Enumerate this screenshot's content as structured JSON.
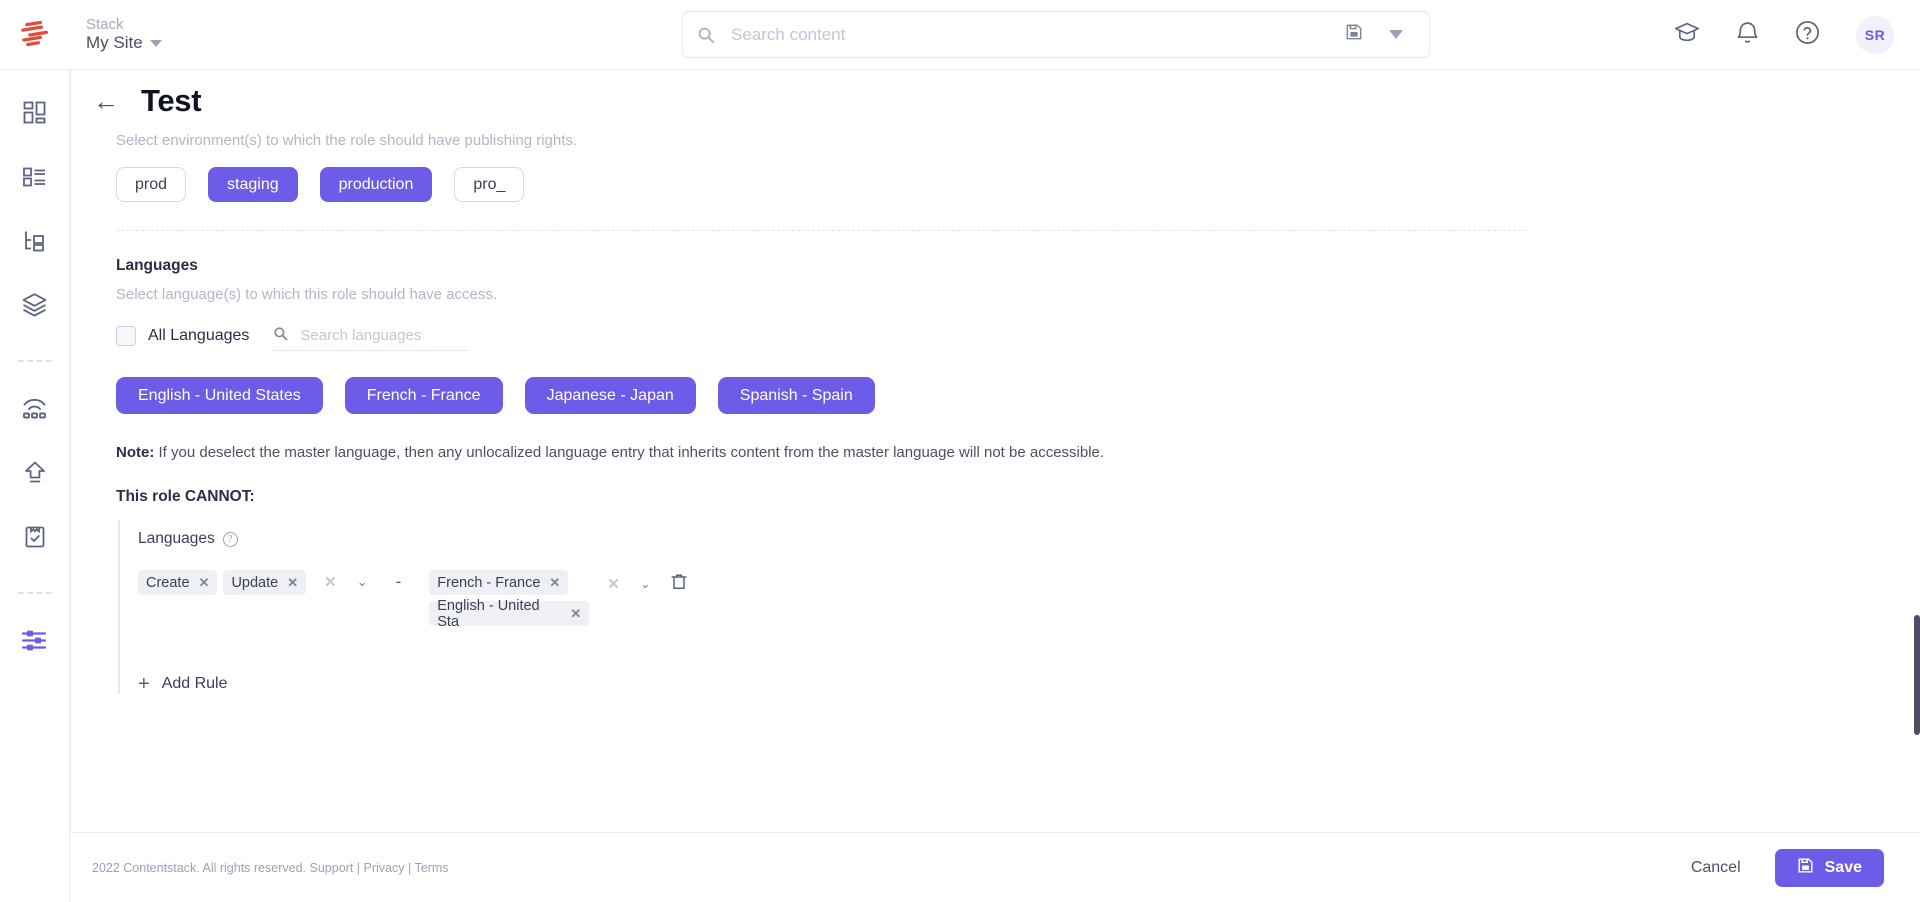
{
  "header": {
    "stack_label": "Stack",
    "stack_name": "My Site",
    "search_placeholder": "Search content",
    "avatar_initials": "SR",
    "icons": {
      "search": "search-icon",
      "save_search": "save-icon",
      "dropdown": "chevron-down-icon",
      "academy": "graduation-cap-icon",
      "notifications": "bell-icon",
      "help": "help-circle-icon"
    }
  },
  "sidebar": {
    "items": [
      {
        "name": "dashboard",
        "icon": "dashboard-grid-icon",
        "active": false
      },
      {
        "name": "content-types",
        "icon": "content-list-icon",
        "active": false
      },
      {
        "name": "taxonomy",
        "icon": "tree-structure-icon",
        "active": false
      },
      {
        "name": "assets",
        "icon": "layers-icon",
        "active": false
      },
      {
        "name": "live-preview",
        "icon": "live-preview-icon",
        "active": false
      },
      {
        "name": "publish-queue",
        "icon": "upload-arrow-icon",
        "active": false
      },
      {
        "name": "audit-log",
        "icon": "clipboard-check-icon",
        "active": false
      },
      {
        "name": "settings",
        "icon": "sliders-icon",
        "active": true
      }
    ]
  },
  "page": {
    "title": "Test",
    "back_label": "←"
  },
  "environments": {
    "description": "Select environment(s) to which the role should have publishing rights.",
    "chips": [
      {
        "label": "prod",
        "selected": false
      },
      {
        "label": "staging",
        "selected": true
      },
      {
        "label": "production",
        "selected": true
      },
      {
        "label": "pro_",
        "selected": false
      }
    ]
  },
  "languages": {
    "title": "Languages",
    "description": "Select language(s) to which this role should have access.",
    "all_languages_label": "All Languages",
    "all_languages_checked": false,
    "search_placeholder": "Search languages",
    "chips": [
      {
        "label": "English - United States",
        "selected": true
      },
      {
        "label": "French - France",
        "selected": true
      },
      {
        "label": "Japanese - Japan",
        "selected": true
      },
      {
        "label": "Spanish - Spain",
        "selected": true
      }
    ]
  },
  "note": {
    "prefix": "Note:",
    "text": " If you deselect the master language, then any unlocalized language entry that inherits content from the master language will not be accessible."
  },
  "rules": {
    "heading": "This role CANNOT:",
    "group_label": "Languages",
    "separator": "-",
    "actions": [
      {
        "label": "Create"
      },
      {
        "label": "Update"
      }
    ],
    "targets": [
      {
        "label": "French - France"
      },
      {
        "label": "English - United Sta"
      }
    ],
    "add_rule_label": "Add Rule",
    "remove_icon": "trash-icon",
    "clear_icon": "clear-x-icon",
    "expand_icon": "chevron-down-icon"
  },
  "footer": {
    "copyright": "2022 Contentstack. All rights reserved.",
    "links": [
      {
        "label": "Support"
      },
      {
        "label": "Privacy"
      },
      {
        "label": "Terms"
      }
    ],
    "separator": "|",
    "cancel_label": "Cancel",
    "save_label": "Save",
    "save_icon": "save-icon"
  },
  "colors": {
    "accent": "#6c5ce7",
    "logo": "#e24c3f",
    "text": "#2b2f45",
    "muted": "#b2b7c6"
  }
}
